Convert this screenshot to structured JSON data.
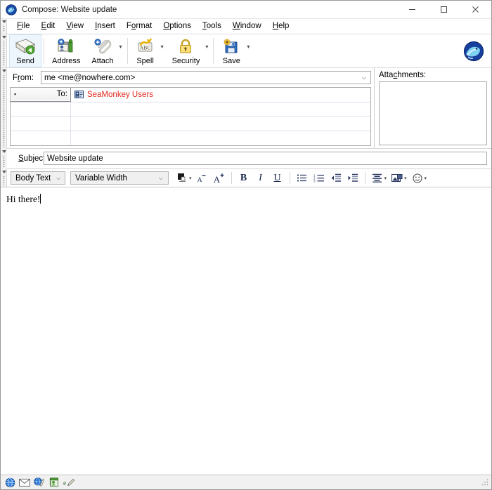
{
  "window": {
    "title": "Compose: Website update",
    "app_icon": "seamonkey-icon",
    "controls": {
      "minimize": "—",
      "maximize": "☐",
      "close": "✕"
    }
  },
  "menubar": {
    "items": [
      {
        "label": "File",
        "accel": "F"
      },
      {
        "label": "Edit",
        "accel": "E"
      },
      {
        "label": "View",
        "accel": "V"
      },
      {
        "label": "Insert",
        "accel": "I"
      },
      {
        "label": "Format",
        "accel": "o"
      },
      {
        "label": "Options",
        "accel": "O"
      },
      {
        "label": "Tools",
        "accel": "T"
      },
      {
        "label": "Window",
        "accel": "W"
      },
      {
        "label": "Help",
        "accel": "H"
      }
    ]
  },
  "toolbar": {
    "buttons": [
      {
        "label": "Send",
        "icon": "send-envelope-icon",
        "has_dropdown": false,
        "active": true
      },
      {
        "label": "Address",
        "icon": "address-book-icon",
        "has_dropdown": false,
        "active": false
      },
      {
        "label": "Attach",
        "icon": "paperclip-icon",
        "has_dropdown": true,
        "active": false
      },
      {
        "label": "Spell",
        "icon": "spellcheck-abc-icon",
        "has_dropdown": true,
        "active": false
      },
      {
        "label": "Security",
        "icon": "padlock-icon",
        "has_dropdown": true,
        "active": false
      },
      {
        "label": "Save",
        "icon": "save-floppy-icon",
        "has_dropdown": true,
        "active": false
      }
    ],
    "logo": "seamonkey-logo-icon",
    "dropdown_glyph": "▾"
  },
  "headers": {
    "from": {
      "label": "From:",
      "value": "me <me@nowhere.com>",
      "dropdown_glyph": "⌵"
    },
    "recipients": {
      "rows": [
        {
          "type": "To:",
          "value": "SeaMonkey Users",
          "icon": "contact-card-icon",
          "filled": true
        },
        {
          "type": "",
          "value": "",
          "icon": "",
          "filled": false
        },
        {
          "type": "",
          "value": "",
          "icon": "",
          "filled": false
        },
        {
          "type": "",
          "value": "",
          "icon": "",
          "filled": false
        }
      ],
      "type_marker": "▪"
    },
    "attachments": {
      "label": "Attachments:",
      "items": []
    },
    "subject": {
      "label": "Subject:",
      "value": "Website update"
    }
  },
  "format_toolbar": {
    "paragraph_style": {
      "value": "Body Text",
      "arrow": "⌵"
    },
    "font_face": {
      "value": "Variable Width",
      "arrow": "⌵"
    },
    "buttons": [
      {
        "name": "text-color-swatch",
        "icon": "color-swatch-icon",
        "has_caret": true
      },
      {
        "name": "decrease-font-size",
        "icon": "font-smaller-icon",
        "has_caret": false
      },
      {
        "name": "increase-font-size",
        "icon": "font-larger-icon",
        "has_caret": false
      },
      {
        "name": "bold",
        "icon": "bold-icon",
        "glyph": "B",
        "has_caret": false
      },
      {
        "name": "italic",
        "icon": "italic-icon",
        "glyph": "I",
        "has_caret": false
      },
      {
        "name": "underline",
        "icon": "underline-icon",
        "glyph": "U",
        "has_caret": false
      },
      {
        "name": "bulleted-list",
        "icon": "bulleted-list-icon",
        "has_caret": false
      },
      {
        "name": "numbered-list",
        "icon": "numbered-list-icon",
        "has_caret": false
      },
      {
        "name": "outdent",
        "icon": "outdent-icon",
        "has_caret": false
      },
      {
        "name": "indent",
        "icon": "indent-icon",
        "has_caret": false
      },
      {
        "name": "align",
        "icon": "align-icon",
        "has_caret": true
      },
      {
        "name": "insert-object",
        "icon": "insert-image-icon",
        "has_caret": true
      },
      {
        "name": "insert-smiley",
        "icon": "smiley-face-icon",
        "has_caret": true
      }
    ],
    "caret_glyph": "▾"
  },
  "body": {
    "text": "Hi there!"
  },
  "statusbar": {
    "icons": [
      {
        "name": "online-globe-icon"
      },
      {
        "name": "mail-envelope-icon"
      },
      {
        "name": "newsgroup-icon"
      },
      {
        "name": "address-book-status-icon"
      },
      {
        "name": "composer-status-icon"
      }
    ],
    "message": ""
  },
  "colors": {
    "recipient_text": "#e02b20",
    "window_bg": "#ffffff",
    "toolbar_bg": "#ffffff",
    "statusbar_bg": "#f1f1f1",
    "field_border": "#a9a9a9",
    "accent_blue": "#1c4fa1"
  }
}
